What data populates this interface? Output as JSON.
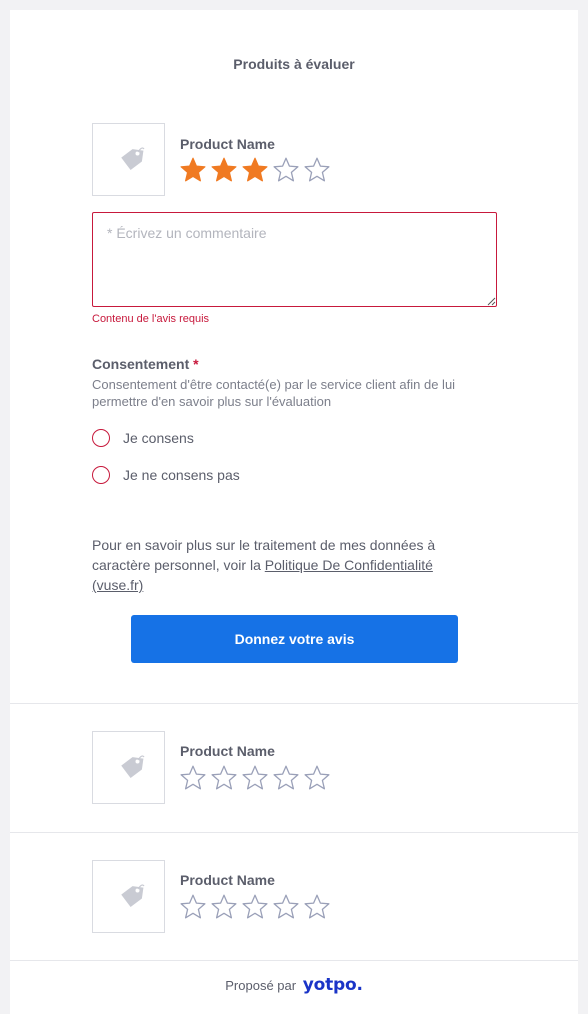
{
  "header": {
    "title": "Produits à évaluer"
  },
  "products": [
    {
      "name": "Product Name",
      "rating": 3,
      "max": 5
    },
    {
      "name": "Product Name",
      "rating": 0,
      "max": 5
    },
    {
      "name": "Product Name",
      "rating": 0,
      "max": 5
    }
  ],
  "review": {
    "placeholder": "* Écrivez un commentaire",
    "value": "",
    "error": "Contenu de l'avis requis"
  },
  "consent": {
    "label": "Consentement",
    "required_mark": "*",
    "description": "Consentement d'être contacté(e) par le service client afin de lui permettre d'en savoir plus sur l'évaluation",
    "options": [
      "Je consens",
      "Je ne consens pas"
    ]
  },
  "privacy": {
    "text_before": "Pour en savoir plus sur le traitement de mes données à caractère personnel, voir la ",
    "link_text": "Politique De Confidentialité (vuse.fr)"
  },
  "submit": {
    "label": "Donnez votre avis"
  },
  "footer": {
    "powered_by": "Proposé par",
    "brand": "yotpo."
  },
  "colors": {
    "star_filled": "#f07a22",
    "star_empty_outline": "#9aa0b8",
    "error": "#c7193c",
    "primary_button": "#1672e6",
    "brand": "#1a34c7"
  },
  "icons": {
    "product_placeholder": "tag-icon",
    "star": "star-icon"
  }
}
